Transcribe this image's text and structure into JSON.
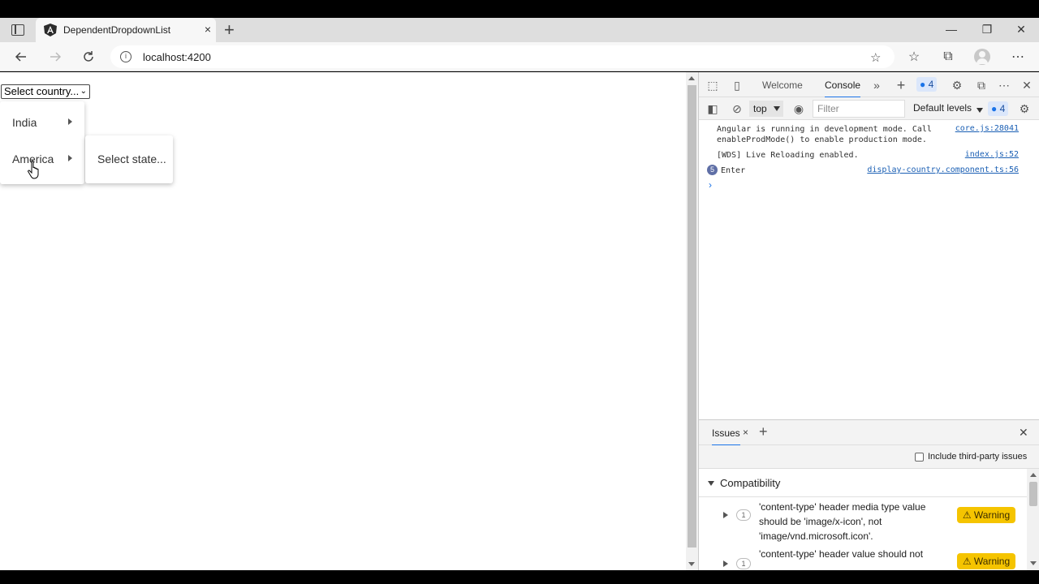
{
  "browser": {
    "tab_title": "DependentDropdownList",
    "tab_close": "×",
    "new_tab": "+",
    "url": "localhost:4200",
    "window_controls": {
      "minimize": "—",
      "restore": "❐",
      "close": "✕"
    }
  },
  "page": {
    "select_country": "Select country...",
    "country_menu": [
      {
        "label": "India"
      },
      {
        "label": "America"
      }
    ],
    "state_menu": {
      "label": "Select state..."
    }
  },
  "devtools": {
    "tabs": {
      "welcome": "Welcome",
      "console": "Console"
    },
    "issues_badge": "4",
    "toolbar": {
      "context": "top",
      "filter_placeholder": "Filter",
      "levels": "Default levels",
      "issues_count": "4"
    },
    "messages": [
      {
        "text_line1": "Angular is running in development mode. Call",
        "text_line2": "enableProdMode() to enable production mode.",
        "source": "core.js:28041"
      },
      {
        "text_line1": "[WDS] Live Reloading enabled.",
        "source": "index.js:52"
      },
      {
        "count": "5",
        "text_line1": "Enter",
        "source": "display-country.component.ts:56"
      }
    ],
    "drawer": {
      "tab": "Issues",
      "include_third_party": "Include third-party issues",
      "section": "Compatibility",
      "issues": [
        {
          "count": "1",
          "line1": "'content-type' header media type value",
          "line2": "should be 'image/x-icon', not",
          "line3": "'image/vnd.microsoft.icon'.",
          "badge": "⚠ Warning"
        },
        {
          "count": "1",
          "line1": "'content-type' header value should not",
          "badge": "⚠ Warning"
        }
      ]
    }
  },
  "colors": {
    "accent": "#1a73e8",
    "warning": "#f5c400",
    "link": "#1a5fb4"
  }
}
